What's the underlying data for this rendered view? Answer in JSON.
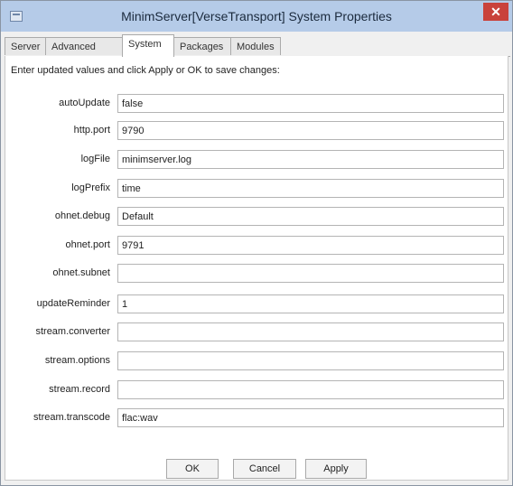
{
  "window": {
    "title": "MinimServer[VerseTransport] System Properties",
    "close_label": "✕"
  },
  "tabs": [
    "Server",
    "Advanced",
    "System",
    "Packages",
    "Modules"
  ],
  "active_tab": "System",
  "instructions": "Enter updated values and click Apply or OK to save changes:",
  "properties": [
    {
      "label": "autoUpdate",
      "value": "false"
    },
    {
      "label": "http.port",
      "value": "9790"
    },
    {
      "label": "logFile",
      "value": "minimserver.log"
    },
    {
      "label": "logPrefix",
      "value": "time"
    },
    {
      "label": "ohnet.debug",
      "value": "Default"
    },
    {
      "label": "ohnet.port",
      "value": "9791"
    },
    {
      "label": "ohnet.subnet",
      "value": ""
    },
    {
      "label": "updateReminder",
      "value": "1"
    },
    {
      "label": "stream.converter",
      "value": ""
    },
    {
      "label": "stream.options",
      "value": ""
    },
    {
      "label": "stream.record",
      "value": ""
    },
    {
      "label": "stream.transcode",
      "value": "flac:wav"
    }
  ],
  "buttons": {
    "ok": "OK",
    "cancel": "Cancel",
    "apply": "Apply"
  }
}
